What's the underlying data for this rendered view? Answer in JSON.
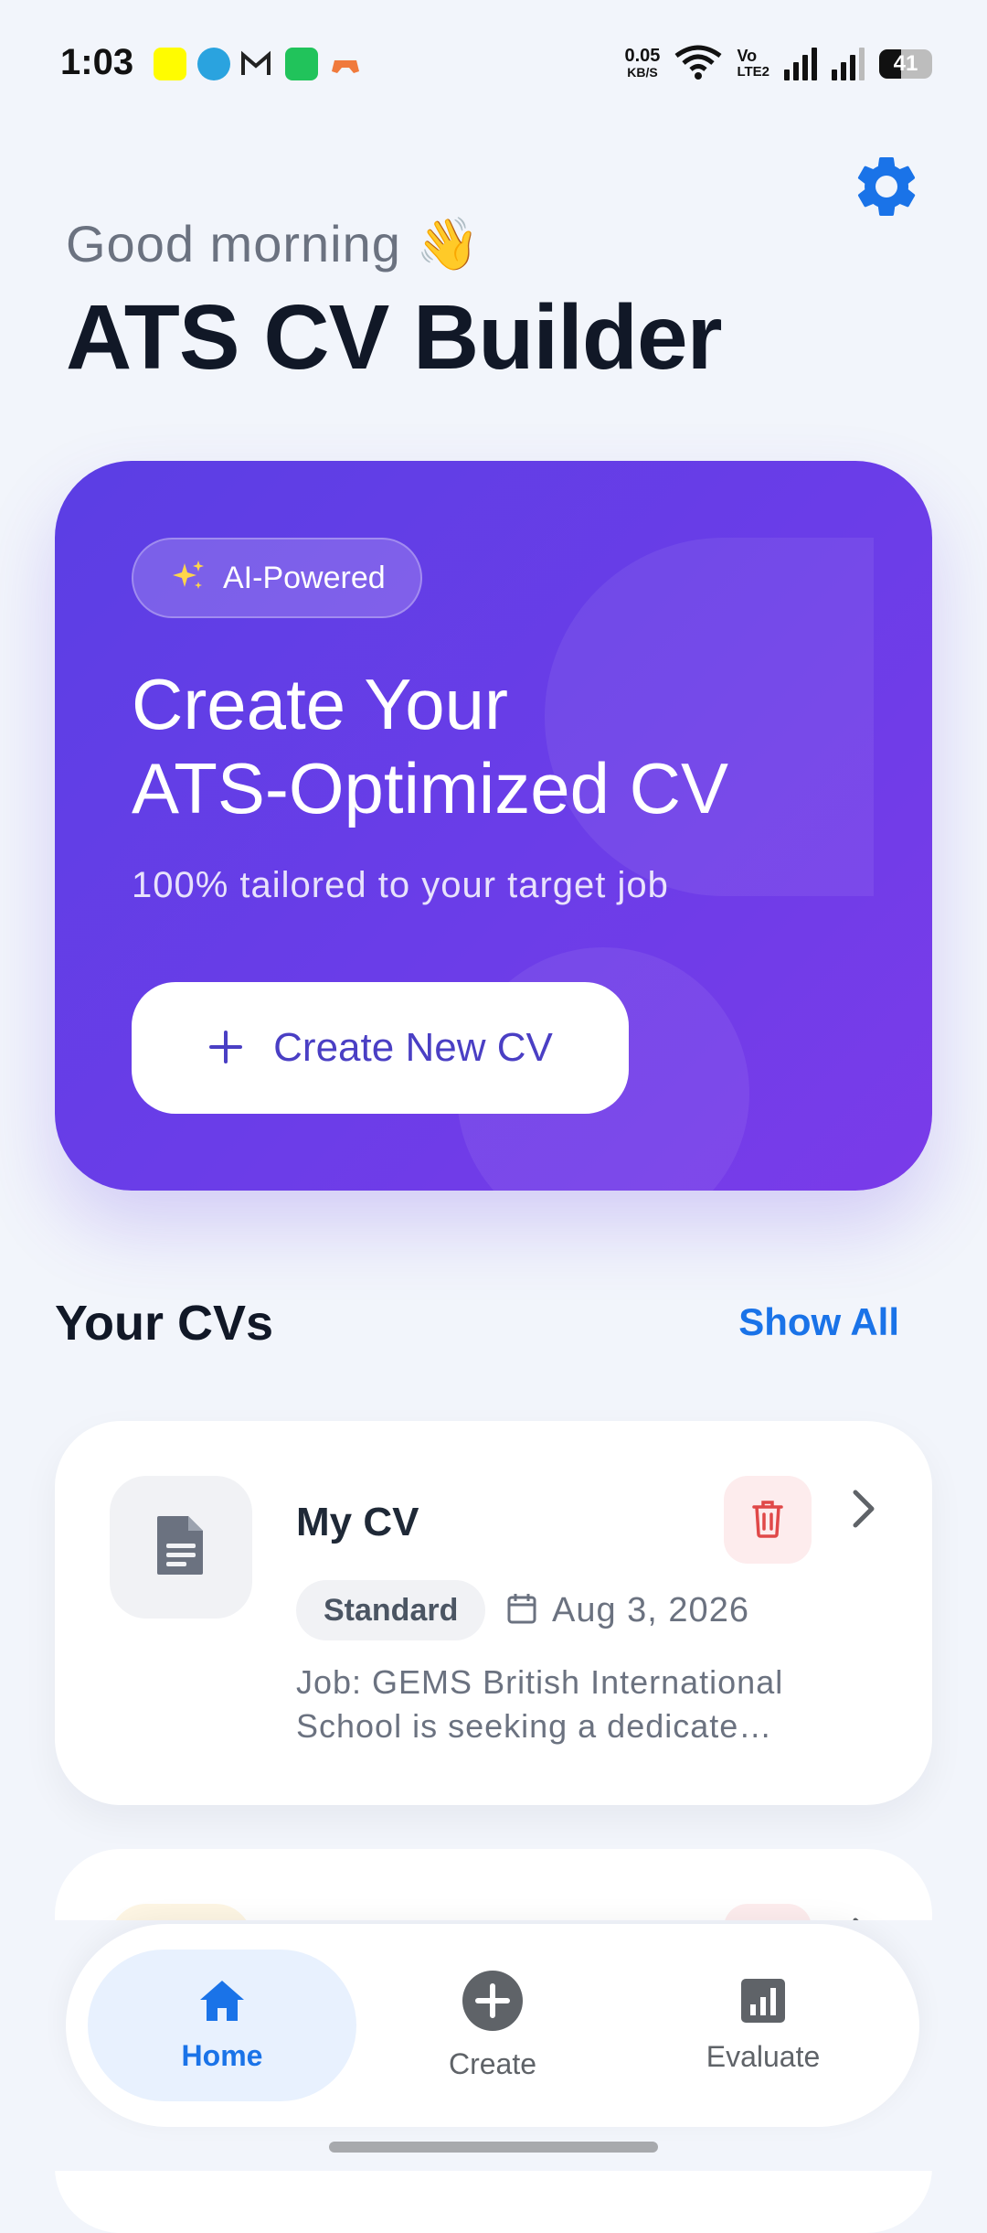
{
  "status_bar": {
    "time": "1:03",
    "net_speed_value": "0.05",
    "net_speed_unit": "KB/S",
    "lte_label_top": "Vo",
    "lte_label_bottom": "LTE2",
    "battery_level": "41",
    "notification_apps": [
      "snapchat-icon",
      "telegram-icon",
      "gmail-icon",
      "sheets-icon",
      "game-icon"
    ]
  },
  "header": {
    "greeting": "Good morning 👋",
    "title": "ATS CV Builder"
  },
  "hero": {
    "badge_label": "AI-Powered",
    "title": "Create Your\nATS-Optimized CV",
    "subtitle": "100% tailored to your target job",
    "button_label": "Create New CV"
  },
  "cvs_section": {
    "title": "Your CVs",
    "show_all_label": "Show All",
    "items": [
      {
        "title": "My CV",
        "template": "Standard",
        "date": "Aug 3, 2026",
        "job": "Job: GEMS British International School is seeking a dedicate…"
      }
    ]
  },
  "bottom_nav": {
    "items": [
      {
        "label": "Home",
        "icon": "home-icon",
        "active": true
      },
      {
        "label": "Create",
        "icon": "add-circle-icon",
        "active": false
      },
      {
        "label": "Evaluate",
        "icon": "bar-chart-icon",
        "active": false
      }
    ]
  },
  "colors": {
    "accent": "#1a73e8",
    "hero_gradient_start": "#5b3ee4",
    "hero_gradient_end": "#7a3be9",
    "delete": "#e04848",
    "background": "#f2f5fb"
  }
}
